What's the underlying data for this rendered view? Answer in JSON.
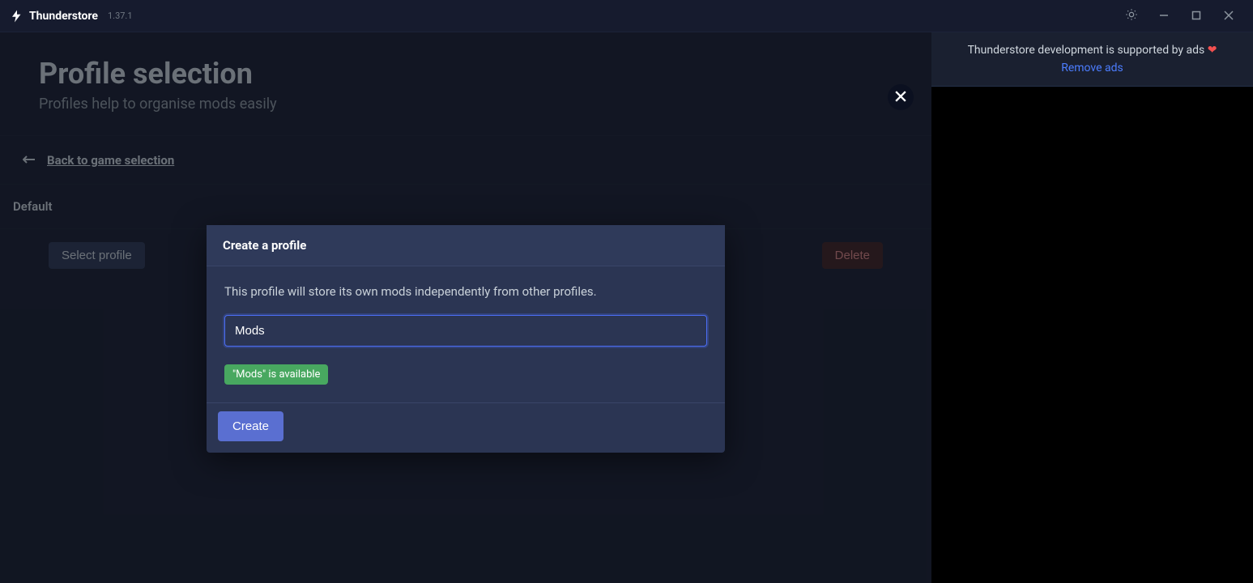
{
  "app": {
    "name": "Thunderstore",
    "version": "1.37.1"
  },
  "ads": {
    "message": "Thunderstore development is supported by ads",
    "heart": "❤",
    "remove_link": "Remove ads"
  },
  "page": {
    "title": "Profile selection",
    "subtitle": "Profiles help to organise mods easily",
    "back_label": "Back to game selection"
  },
  "profiles": {
    "default_name": "Default"
  },
  "actions": {
    "select_label": "Select profile",
    "delete_label": "Delete"
  },
  "modal": {
    "title": "Create a profile",
    "description": "This profile will store its own mods independently from other profiles.",
    "input_value": "Mods",
    "status_text": "\"Mods\" is available",
    "create_label": "Create"
  }
}
